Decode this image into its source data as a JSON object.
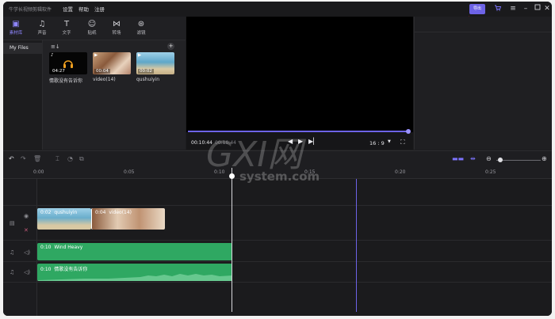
{
  "app": {
    "title": "牛学长视频剪辑软件",
    "menu": [
      "设置",
      "帮助",
      "注册"
    ],
    "export_label": "导出"
  },
  "media_tabs": [
    {
      "label": "素材库",
      "icon": "media-library-icon"
    },
    {
      "label": "声音",
      "icon": "music-note-icon"
    },
    {
      "label": "文字",
      "icon": "text-icon"
    },
    {
      "label": "贴纸",
      "icon": "sticker-icon"
    },
    {
      "label": "转场",
      "icon": "transition-icon"
    },
    {
      "label": "滤镜",
      "icon": "filter-icon"
    }
  ],
  "sidebar": {
    "my_files": "My Files"
  },
  "media_items": [
    {
      "label": "情歌没有告诉你",
      "duration": "04:27",
      "kind": "audio"
    },
    {
      "label": "video(14)",
      "duration": "00:04",
      "kind": "video"
    },
    {
      "label": "qushuiyin",
      "duration": "00:02",
      "kind": "video"
    }
  ],
  "preview": {
    "current_time": "00:10:44",
    "total_time": "00:10:44",
    "aspect_ratio": "16 : 9"
  },
  "ruler_ticks": [
    "0:00",
    "0:05",
    "0:10",
    "0:15",
    "0:20",
    "0:25"
  ],
  "tracks": {
    "video_clips": [
      {
        "duration": "0:02",
        "name": "qushuiyin"
      },
      {
        "duration": "0:04",
        "name": "video(14)"
      }
    ],
    "audio_clips": [
      {
        "duration": "0:10",
        "name": "Wind Heavy"
      },
      {
        "duration": "0:10",
        "name": "情歌没有告诉你"
      }
    ]
  },
  "watermark": {
    "text": "G X I 网",
    "sub": "system.com"
  },
  "colors": {
    "accent": "#6d63e6",
    "audio_clip": "#2fa862",
    "background": "#1d1d1f"
  }
}
